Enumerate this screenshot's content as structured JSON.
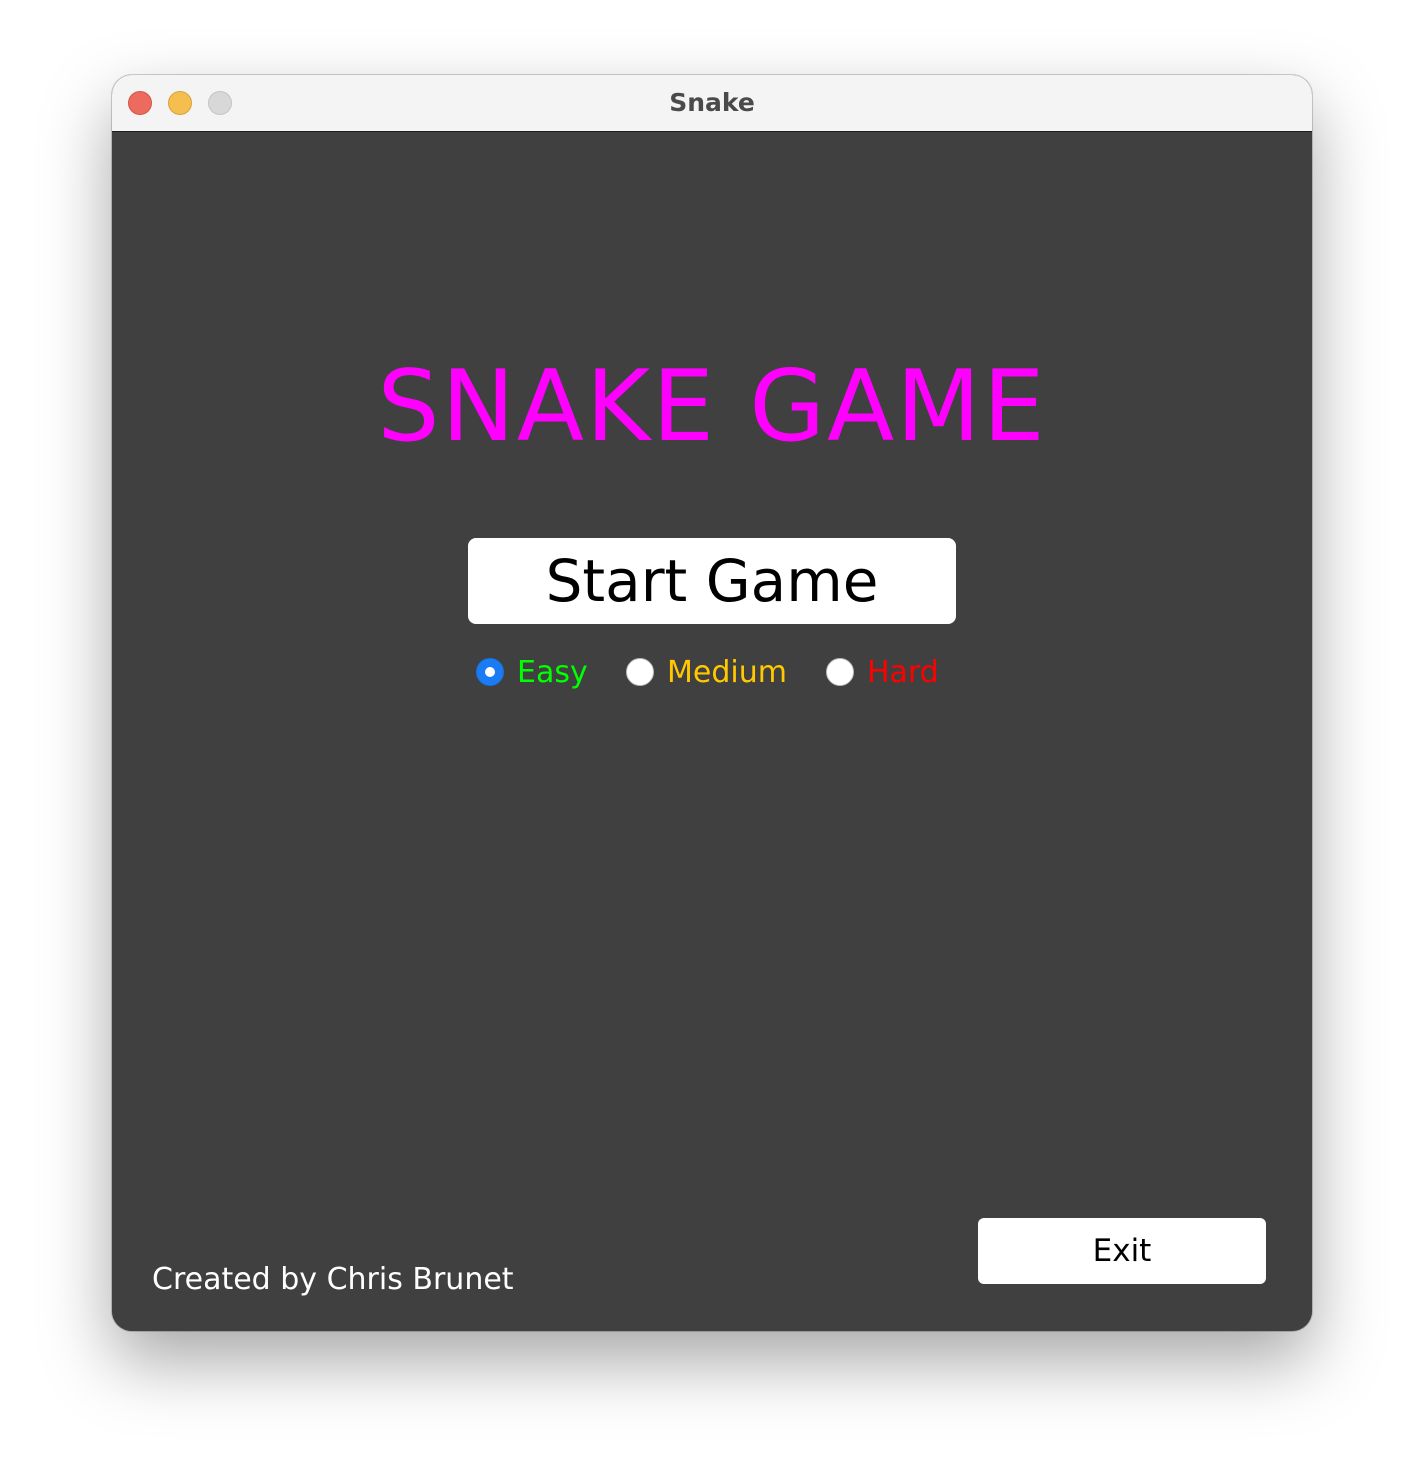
{
  "window": {
    "title": "Snake"
  },
  "game": {
    "title": "SNAKE GAME",
    "title_color": "#ff00ff",
    "start_label": "Start Game",
    "difficulty": {
      "selected": "Easy",
      "options": [
        {
          "label": "Easy",
          "color": "#00ff00",
          "checked": true
        },
        {
          "label": "Medium",
          "color": "#ffc800",
          "checked": false
        },
        {
          "label": "Hard",
          "color": "#ff0000",
          "checked": false
        }
      ]
    },
    "exit_label": "Exit",
    "credit": "Created by Chris Brunet"
  },
  "colors": {
    "background": "#404040",
    "radio_accent": "#1a7cf5"
  }
}
